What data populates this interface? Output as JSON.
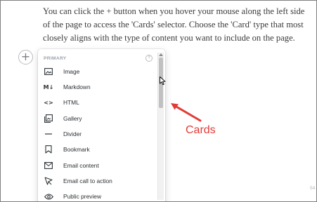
{
  "intro_text": "You can click the + button when you hover your mouse along the left side of the page to access the 'Cards' selector. Choose the 'Card' type that most closely aligns with the type of content you want to include on the page.",
  "plus_button": "+",
  "menu": {
    "header": "PRIMARY",
    "help_icon": "?",
    "items": [
      {
        "label": "Image",
        "icon": "image-icon"
      },
      {
        "label": "Markdown",
        "icon": "markdown-icon",
        "glyph": "M↓"
      },
      {
        "label": "HTML",
        "icon": "code-icon",
        "glyph": "<>"
      },
      {
        "label": "Gallery",
        "icon": "gallery-icon"
      },
      {
        "label": "Divider",
        "icon": "divider-icon"
      },
      {
        "label": "Bookmark",
        "icon": "bookmark-icon"
      },
      {
        "label": "Email content",
        "icon": "email-icon"
      },
      {
        "label": "Email call to action",
        "icon": "pointer-icon"
      },
      {
        "label": "Public preview",
        "icon": "eye-icon"
      }
    ]
  },
  "annotation": {
    "label": "Cards",
    "color": "#e23b36"
  },
  "page_number": "54"
}
